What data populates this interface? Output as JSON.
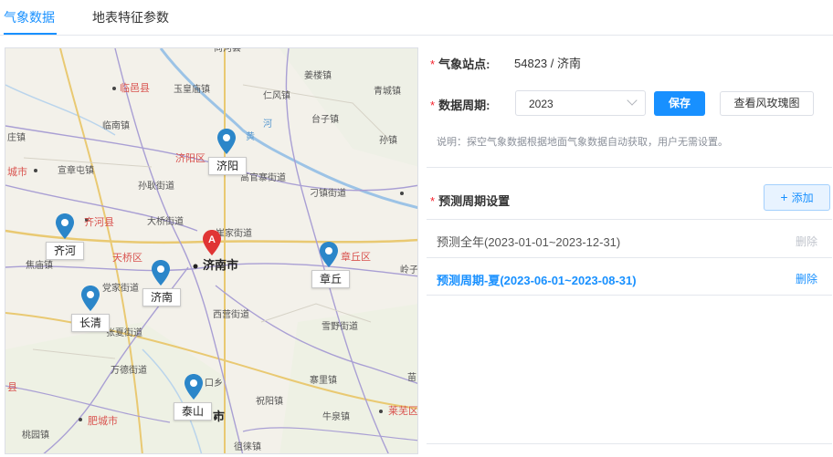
{
  "tabs": [
    {
      "label": "气象数据",
      "active": true
    },
    {
      "label": "地表特征参数",
      "active": false
    }
  ],
  "map": {
    "places": [
      {
        "text": "尚河县"
      },
      {
        "text": "临邑县"
      },
      {
        "text": "玉皇庙镇"
      },
      {
        "text": "姜楼镇"
      },
      {
        "text": "仁风镇"
      },
      {
        "text": "青城镇"
      },
      {
        "text": "临南镇"
      },
      {
        "text": "台子镇"
      },
      {
        "text": "庄镇"
      },
      {
        "text": "济阳区"
      },
      {
        "text": "孙镇"
      },
      {
        "text": "城市"
      },
      {
        "text": "宣章屯镇"
      },
      {
        "text": "高官寨街道"
      },
      {
        "text": "孙耿街道"
      },
      {
        "text": "刁镇街道"
      },
      {
        "text": "齐河县"
      },
      {
        "text": "大桥街道"
      },
      {
        "text": "崔家街道"
      },
      {
        "text": "天桥区"
      },
      {
        "text": "章丘区"
      },
      {
        "text": "焦庙镇"
      },
      {
        "text": "济南市"
      },
      {
        "text": "岭子"
      },
      {
        "text": "党家街道"
      },
      {
        "text": "西营街道"
      },
      {
        "text": "张夏街道"
      },
      {
        "text": "雪野街道"
      },
      {
        "text": "万德街道"
      },
      {
        "text": "口乡"
      },
      {
        "text": "苗"
      },
      {
        "text": "县"
      },
      {
        "text": "寨里镇"
      },
      {
        "text": "祝阳镇"
      },
      {
        "text": "肥城市"
      },
      {
        "text": "市"
      },
      {
        "text": "牛泉镇"
      },
      {
        "text": "莱芜区"
      },
      {
        "text": "桃园镇"
      },
      {
        "text": "徂徕镇"
      },
      {
        "text": "河"
      },
      {
        "text": "黄"
      }
    ],
    "stations": [
      {
        "name": "济阳"
      },
      {
        "name": "齐河"
      },
      {
        "name": "济南"
      },
      {
        "name": "长清"
      },
      {
        "name": "章丘"
      },
      {
        "name": "泰山"
      }
    ],
    "selected_marker": "A",
    "colors": {
      "pin": "#2b86c9",
      "selected_pin": "#e03535",
      "road": "#a99fd4",
      "road_major": "#e9c972",
      "river": "#9cc3e6"
    }
  },
  "form": {
    "station_label": "气象站点:",
    "station_value": "54823 / 济南",
    "period_label": "数据周期:",
    "year_value": "2023",
    "save_label": "保存",
    "wind_rose_label": "查看风玫瑰图",
    "note": "说明：探空气象数据根据地面气象数据自动获取，用户无需设置。",
    "forecast_title": "预测周期设置",
    "add_label": "添加",
    "add_icon": "plus-icon",
    "periods": [
      {
        "label": "预测全年(2023-01-01~2023-12-31)",
        "delete": "删除",
        "active": false
      },
      {
        "label": "预测周期-夏(2023-06-01~2023-08-31)",
        "delete": "删除",
        "active": true
      }
    ]
  },
  "colors": {
    "accent": "#1890ff",
    "required": "#f5222d",
    "muted": "#8a8f99"
  }
}
